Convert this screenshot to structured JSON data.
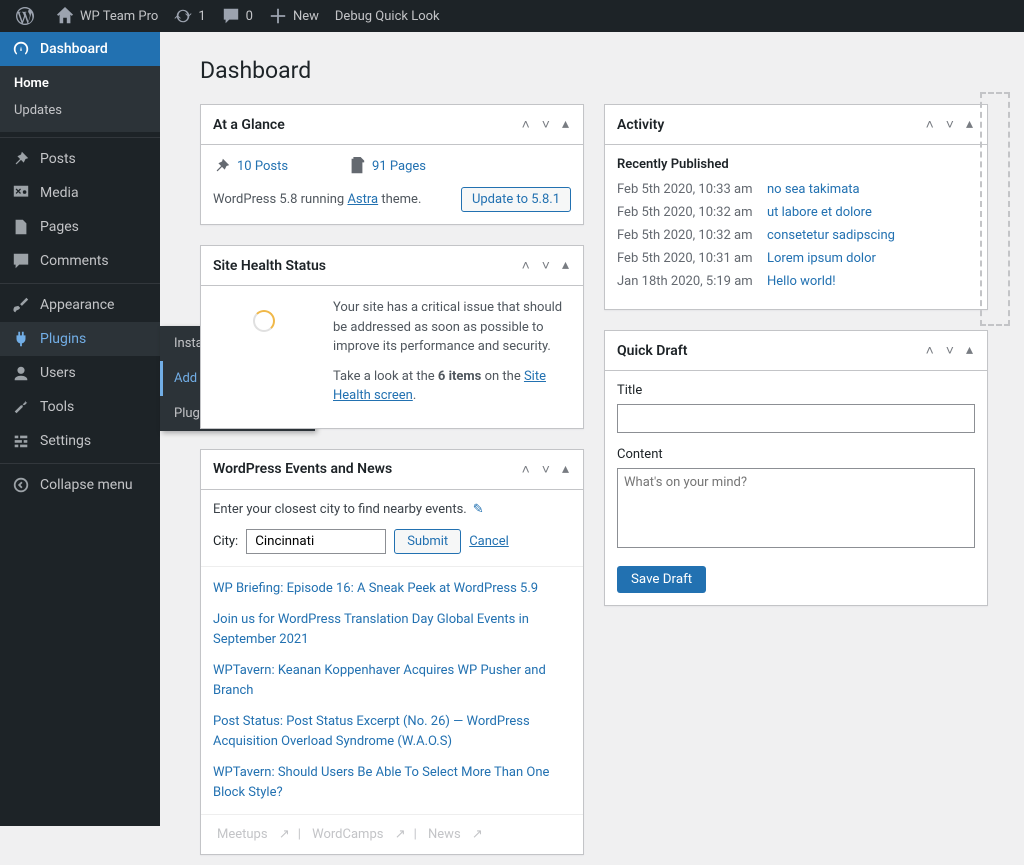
{
  "adminBar": {
    "siteName": "WP Team Pro",
    "updates": "1",
    "comments": "0",
    "new": "New",
    "debug": "Debug Quick Look"
  },
  "sidebar": {
    "dashboard": "Dashboard",
    "dashSub": {
      "home": "Home",
      "updates": "Updates"
    },
    "posts": "Posts",
    "media": "Media",
    "pages": "Pages",
    "comments": "Comments",
    "appearance": "Appearance",
    "plugins": "Plugins",
    "users": "Users",
    "tools": "Tools",
    "settings": "Settings",
    "collapse": "Collapse menu"
  },
  "flyout": {
    "installed": "Installed Plugins",
    "addNew": "Add New",
    "editor": "Plugin Editor"
  },
  "page": {
    "title": "Dashboard"
  },
  "glance": {
    "title": "At a Glance",
    "posts": "10 Posts",
    "pages": "91 Pages",
    "running1": "WordPress 5.8 running ",
    "theme": "Astra",
    "running2": " theme.",
    "update": "Update to 5.8.1"
  },
  "health": {
    "title": "Site Health Status",
    "p1": "Your site has a critical issue that should be addressed as soon as possible to improve its performance and security.",
    "p2a": "Take a look at the ",
    "p2b": "6 items",
    "p2c": " on the ",
    "link": "Site Health screen",
    "dot": "."
  },
  "events": {
    "title": "WordPress Events and News",
    "prompt": "Enter your closest city to find nearby events.",
    "cityLabel": "City:",
    "cityValue": "Cincinnati",
    "submit": "Submit",
    "cancel": "Cancel",
    "news": [
      "WP Briefing: Episode 16: A Sneak Peek at WordPress 5.9",
      "Join us for WordPress Translation Day Global Events in September 2021",
      "WPTavern: Keanan Koppenhaver Acquires WP Pusher and Branch",
      "Post Status: Post Status Excerpt (No. 26) — WordPress Acquisition Overload Syndrome (W.A.O.S)",
      "WPTavern: Should Users Be Able To Select More Than One Block Style?"
    ],
    "footLinks": {
      "meetups": "Meetups",
      "wordcamps": "WordCamps",
      "news": "News"
    }
  },
  "activity": {
    "title": "Activity",
    "recent": "Recently Published",
    "rows": [
      {
        "t": "Feb 5th 2020, 10:33 am",
        "l": "no sea takimata"
      },
      {
        "t": "Feb 5th 2020, 10:32 am",
        "l": "ut labore et dolore"
      },
      {
        "t": "Feb 5th 2020, 10:32 am",
        "l": "consetetur sadipscing"
      },
      {
        "t": "Feb 5th 2020, 10:31 am",
        "l": "Lorem ipsum dolor"
      },
      {
        "t": "Jan 18th 2020, 5:19 am",
        "l": "Hello world!"
      }
    ]
  },
  "draft": {
    "title": "Quick Draft",
    "titleLabel": "Title",
    "contentLabel": "Content",
    "placeholder": "What's on your mind?",
    "save": "Save Draft"
  }
}
